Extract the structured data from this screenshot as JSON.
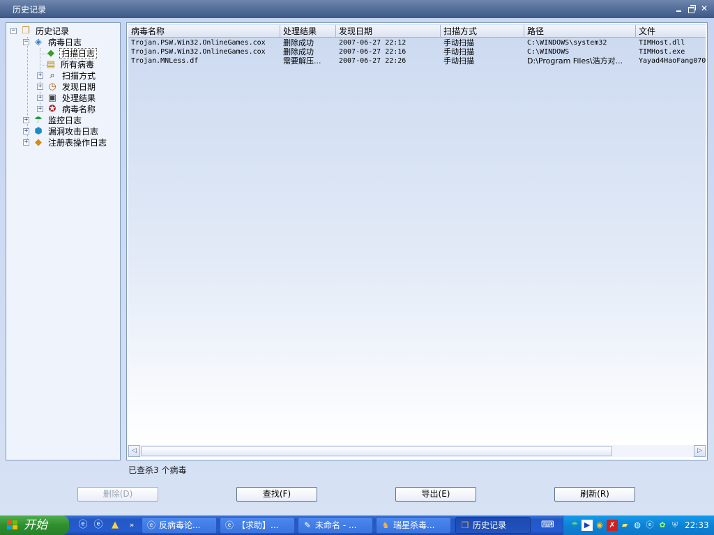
{
  "window": {
    "title": "历史记录"
  },
  "tree": {
    "root": {
      "label": "历史记录",
      "expander": "−"
    },
    "virus_log": {
      "label": "病毒日志",
      "expander": "−"
    },
    "scan_log": {
      "label": "扫描日志"
    },
    "all_viruses": {
      "label": "所有病毒"
    },
    "scan_method": {
      "label": "扫描方式",
      "expander": "+"
    },
    "found_date": {
      "label": "发现日期",
      "expander": "+"
    },
    "process_result": {
      "label": "处理结果",
      "expander": "+"
    },
    "virus_name": {
      "label": "病毒名称",
      "expander": "+"
    },
    "monitor_log": {
      "label": "监控日志",
      "expander": "+"
    },
    "exploit_log": {
      "label": "漏洞攻击日志",
      "expander": "+"
    },
    "registry_log": {
      "label": "注册表操作日志",
      "expander": "+"
    }
  },
  "table": {
    "columns": [
      "病毒名称",
      "处理结果",
      "发现日期",
      "扫描方式",
      "路径",
      "文件"
    ],
    "rows": [
      [
        "Trojan.PSW.Win32.OnlineGames.cox",
        "删除成功",
        "2007-06-27 22:12",
        "手动扫描",
        "C:\\WINDOWS\\system32",
        "TIMHost.dll"
      ],
      [
        "Trojan.PSW.Win32.OnlineGames.cox",
        "删除成功",
        "2007-06-27 22:16",
        "手动扫描",
        "C:\\WINDOWS",
        "TIMHost.exe"
      ],
      [
        "Trojan.MNLess.df",
        "需要解压...",
        "2007-06-27 22:26",
        "手动扫描",
        "D:\\Program Files\\浩方对...",
        "Yayad4HaoFang070"
      ]
    ]
  },
  "status": {
    "text": "已查杀3 个病毒"
  },
  "buttons": {
    "delete": "删除(D)",
    "find": "查找(F)",
    "export": "导出(E)",
    "refresh": "刷新(R)"
  },
  "taskbar": {
    "start": "开始",
    "tasks": [
      "反病毒论...",
      "【求助】...",
      "未命名 - ...",
      "瑞星杀毒...",
      "历史记录"
    ],
    "clock": "22:33",
    "quicklaunch_more": "»"
  },
  "icons": {
    "app": "history-books-icon",
    "virus_log": "virus-log-icon",
    "scan": "scan-icon",
    "monitor": "monitor-umbrella-icon",
    "exploit": "exploit-shield-icon",
    "registry": "registry-cube-icon"
  },
  "colors": {
    "titlebar": "#4f6a97",
    "taskbar": "#245bd0",
    "start": "#2f8f2f",
    "tray": "#0d83d7"
  }
}
